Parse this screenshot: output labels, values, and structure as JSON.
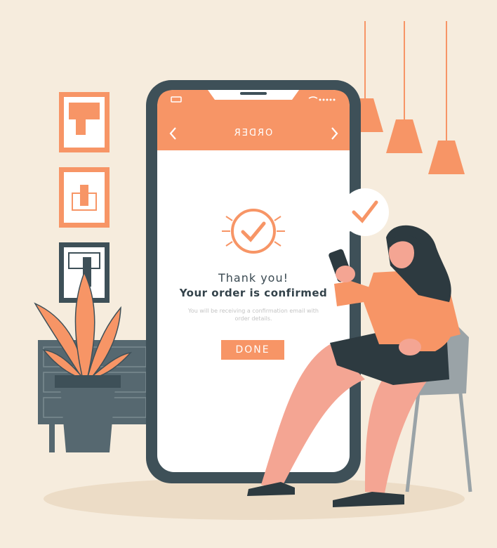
{
  "phone": {
    "header_title": "ORDER",
    "nav_back_icon": "chevron-left-icon",
    "nav_forward_icon": "chevron-right-icon"
  },
  "confirmation": {
    "thanks": "Thank you!",
    "headline": "Your order is confirmed",
    "subtext": "You will be receiving a confirmation email with order details.",
    "done_label": "DONE"
  },
  "colors": {
    "background": "#f6ecdd",
    "accent": "#f79566",
    "phone_frame": "#3e5058",
    "screen": "#ffffff",
    "skin": "#f4a593",
    "dark": "#2d3a40"
  }
}
